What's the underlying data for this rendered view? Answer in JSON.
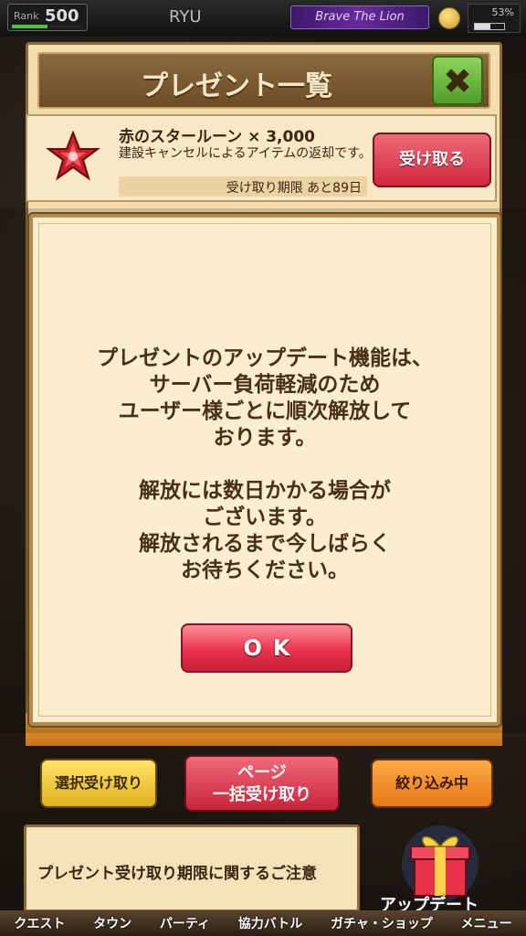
{
  "status_bar": {
    "rank_label": "Rank",
    "rank_value": "500",
    "rank_progress_fraction": 0.5,
    "player_name": "RYU",
    "title_badge": "Brave The Lion",
    "battery_percent": "53%",
    "battery_fraction": 0.53
  },
  "panel": {
    "title": "プレゼント一覧",
    "close_icon": "close-x-icon"
  },
  "present_item": {
    "name": "赤のスタールーン × 3,000",
    "description": "建設キャンセルによるアイテムの返却です。",
    "limit": "受け取り期限 あと89日",
    "receive_label": "受け取る",
    "icon": "red-star-rune-icon",
    "icon_color": "#c8202a"
  },
  "bottom_buttons": {
    "select_receive": "選択受け取り",
    "page_receive_line1": "ページ",
    "page_receive_line2": "一括受け取り",
    "filter": "絞り込み中"
  },
  "notice": {
    "text": "プレゼント受け取り期限に関するご注意"
  },
  "update": {
    "label": "アップデート",
    "icon": "gift-box-icon"
  },
  "nav": {
    "items": [
      "クエスト",
      "タウン",
      "パーティ",
      "協力バトル",
      "ガチャ・ショップ",
      "メニュー"
    ]
  },
  "dialog": {
    "lines": [
      "プレゼントのアップデート機能は、",
      "サーバー負荷軽減のため",
      "ユーザー様ごとに順次解放して",
      "おります。",
      "",
      "解放には数日かかる場合が",
      "ございます。",
      "解放されるまで今しばらく",
      "お待ちください。"
    ],
    "ok_label": "OK"
  }
}
